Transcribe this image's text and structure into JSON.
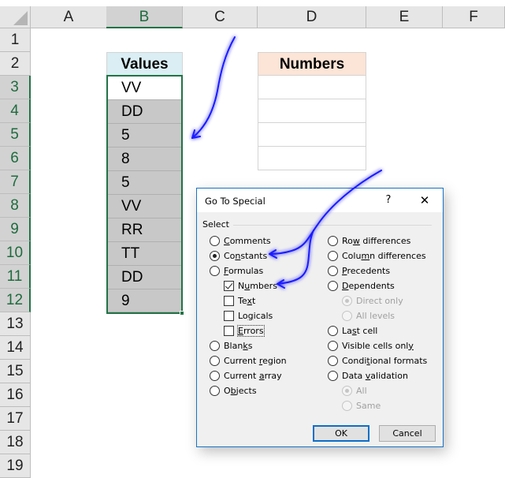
{
  "spreadsheet": {
    "columns": [
      "A",
      "B",
      "C",
      "D",
      "E",
      "F"
    ],
    "selected_column": "B",
    "rows": [
      "1",
      "2",
      "3",
      "4",
      "5",
      "6",
      "7",
      "8",
      "9",
      "10",
      "11",
      "12",
      "13",
      "14",
      "15",
      "16",
      "17",
      "18",
      "19"
    ],
    "selected_rows": [
      "3",
      "4",
      "5",
      "6",
      "7",
      "8",
      "9",
      "10",
      "11",
      "12"
    ],
    "values_table": {
      "header": "Values",
      "cells": [
        "VV",
        "DD",
        "5",
        "8",
        "5",
        "VV",
        "RR",
        "TT",
        "DD",
        "9"
      ],
      "active_cell": "B3"
    },
    "numbers_table": {
      "header": "Numbers",
      "cells": [
        "",
        "",
        "",
        ""
      ]
    },
    "colors": {
      "values_header_bg": "#daeef3",
      "numbers_header_bg": "#fce4d6",
      "selection_border": "#217346",
      "selection_fill": "#c8c8c8",
      "arrow": "#1a1aff"
    }
  },
  "dialog": {
    "title": "Go To Special",
    "help_label": "?",
    "close_label": "✕",
    "group_label": "Select",
    "left_options": [
      {
        "pre": "",
        "key": "C",
        "post": "omments",
        "type": "radio",
        "checked": false
      },
      {
        "pre": "Co",
        "key": "n",
        "post": "stants",
        "type": "radio",
        "checked": true
      },
      {
        "pre": "",
        "key": "F",
        "post": "ormulas",
        "type": "radio",
        "checked": false
      },
      {
        "pre": "N",
        "key": "u",
        "post": "mbers",
        "type": "checkbox",
        "checked": true
      },
      {
        "pre": "Te",
        "key": "x",
        "post": "t",
        "type": "checkbox",
        "checked": false
      },
      {
        "pre": "Lo",
        "key": "g",
        "post": "icals",
        "type": "checkbox",
        "checked": false
      },
      {
        "pre": "",
        "key": "E",
        "post": "rrors",
        "type": "checkbox",
        "checked": false
      },
      {
        "pre": "Blan",
        "key": "k",
        "post": "s",
        "type": "radio",
        "checked": false
      },
      {
        "pre": "Current ",
        "key": "r",
        "post": "egion",
        "type": "radio",
        "checked": false
      },
      {
        "pre": "Current ",
        "key": "a",
        "post": "rray",
        "type": "radio",
        "checked": false
      },
      {
        "pre": "O",
        "key": "b",
        "post": "jects",
        "type": "radio",
        "checked": false
      }
    ],
    "right_options": [
      {
        "pre": "Ro",
        "key": "w",
        "post": " differences",
        "type": "radio",
        "checked": false
      },
      {
        "pre": "Colu",
        "key": "m",
        "post": "n differences",
        "type": "radio",
        "checked": false
      },
      {
        "pre": "",
        "key": "P",
        "post": "recedents",
        "type": "radio",
        "checked": false
      },
      {
        "pre": "",
        "key": "D",
        "post": "ependents",
        "type": "radio",
        "checked": false
      },
      {
        "pre": "Direct only",
        "key": "",
        "post": "",
        "type": "radio",
        "checked": true,
        "disabled": true
      },
      {
        "pre": "All levels",
        "key": "",
        "post": "",
        "type": "radio",
        "checked": false,
        "disabled": true
      },
      {
        "pre": "La",
        "key": "s",
        "post": "t cell",
        "type": "radio",
        "checked": false
      },
      {
        "pre": "Visible cells onl",
        "key": "y",
        "post": "",
        "type": "radio",
        "checked": false
      },
      {
        "pre": "Condi",
        "key": "t",
        "post": "ional formats",
        "type": "radio",
        "checked": false
      },
      {
        "pre": "Data ",
        "key": "v",
        "post": "alidation",
        "type": "radio",
        "checked": false
      },
      {
        "pre": "All",
        "key": "",
        "post": "",
        "type": "radio",
        "checked": true,
        "disabled": true
      },
      {
        "pre": "Same",
        "key": "",
        "post": "",
        "type": "radio",
        "checked": false,
        "disabled": true
      }
    ],
    "ok_label": "OK",
    "cancel_label": "Cancel"
  }
}
